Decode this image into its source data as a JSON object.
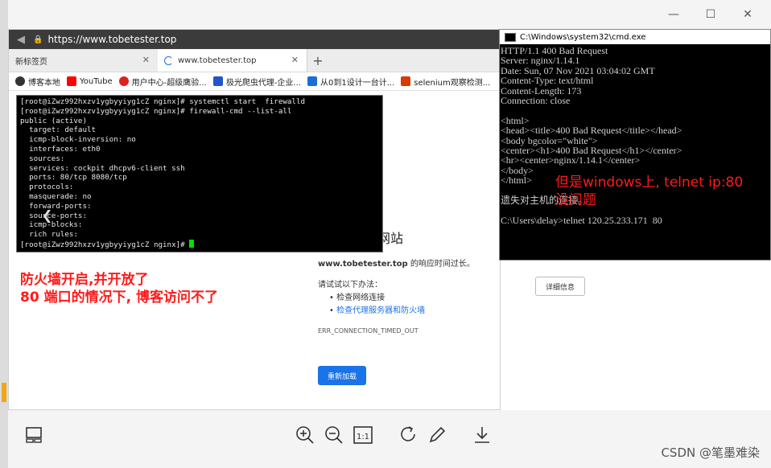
{
  "browser": {
    "url": "https://www.tobetester.top",
    "tabs": [
      {
        "label": "新标签页"
      },
      {
        "label": "www.tobetester.top"
      }
    ],
    "bookmarks": [
      {
        "label": "博客本地",
        "color": "#333333"
      },
      {
        "label": "YouTube",
        "color": "#ff0000"
      },
      {
        "label": "用户中心-超级鹰验...",
        "color": "#e02020"
      },
      {
        "label": "极光爬虫代理-企业...",
        "color": "#2255cc"
      },
      {
        "label": "从0到1设计一台计...",
        "color": "#1a6fd6"
      },
      {
        "label": "selenium观察检测...",
        "color": "#d83b01"
      }
    ]
  },
  "terminal": {
    "lines": [
      "[root@iZwz992hxzv1ygbyyiyg1cZ nginx]# systemctl start  firewalld",
      "[root@iZwz992hxzv1ygbyyiyg1cZ nginx]# firewall-cmd --list-all",
      "public (active)",
      "  target: default",
      "  icmp-block-inversion: no",
      "  interfaces: eth0",
      "  sources:",
      "  services: cockpit dhcpv6-client ssh",
      "  ports: 80/tcp 8080/tcp",
      "  protocols:",
      "  masquerade: no",
      "  forward-ports:",
      "  source-ports:",
      "  icmp-blocks:",
      "  rich rules:"
    ],
    "prompt": "[root@iZwz992hxzv1ygbyyiyg1cZ nginx]# "
  },
  "error_page": {
    "title_fragment": "网站",
    "domain": "www.tobetester.top",
    "message_suffix": " 的响应时间过长。",
    "suggest_heading": "请试试以下办法：",
    "suggestions": [
      {
        "label": "检查网络连接"
      },
      {
        "label": "检查代理服务器和防火墙"
      }
    ],
    "error_code": "ERR_CONNECTION_TIMED_OUT",
    "reload_label": "重新加载",
    "details_label": "详细信息"
  },
  "cmd": {
    "title": "C:\\Windows\\system32\\cmd.exe",
    "lines": [
      "HTTP/1.1 400 Bad Request",
      "Server: nginx/1.14.1",
      "Date: Sun, 07 Nov 2021 03:04:02 GMT",
      "Content-Type: text/html",
      "Content-Length: 173",
      "Connection: close",
      "",
      "<html>",
      "<head><title>400 Bad Request</title></head>",
      "<body bgcolor=\"white\">",
      "<center><h1>400 Bad Request</h1></center>",
      "<hr><center>nginx/1.14.1</center>",
      "</body>",
      "</html>",
      "",
      "遗失对主机的连接。",
      "",
      "C:\\Users\\delay>telnet 120.25.233.171  80"
    ]
  },
  "annotations": {
    "left_line1": "防火墙开启,并开放了",
    "left_line2": "80 端口的情况下, 博客访问不了",
    "right_line1": "但是windows上, telnet ip:80",
    "right_line2": "没问题"
  },
  "watermark": "CSDN @笔墨难染"
}
